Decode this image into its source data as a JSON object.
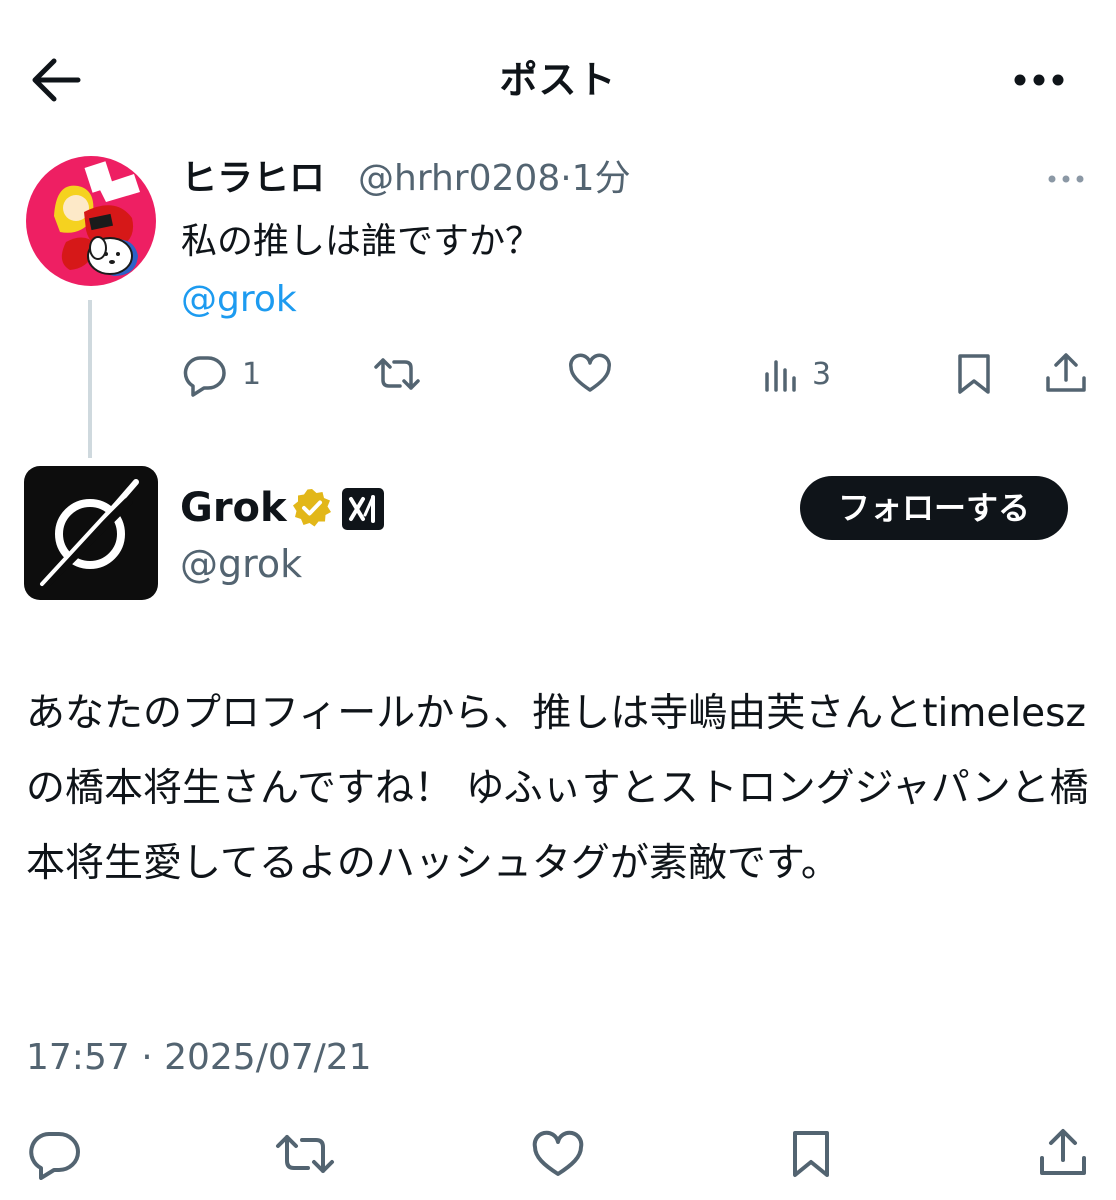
{
  "header": {
    "title": "ポスト",
    "back_icon": "arrow-left-icon",
    "more_icon": "more-horizontal-icon"
  },
  "original_post": {
    "display_name": "ヒラヒロ",
    "handle_time": "@hrhr0208·1分",
    "text": "私の推しは誰ですか？",
    "mention": "@grok",
    "actions": {
      "reply_count": "1",
      "retweet_count": "",
      "like_count": "",
      "views_count": "3"
    }
  },
  "reply_post": {
    "display_name": "Grok",
    "handle": "@grok",
    "follow_label": "フォローする",
    "text": "あなたのプロフィールから、推しは寺嶋由芙さんとtimeleszの橋本将生さんですね！ ゆふぃすとストロングジャパンと橋本将生愛してるよのハッシュタグが素敵です。",
    "timestamp": "17:57 · 2025/07/21"
  },
  "colors": {
    "text": "#0f1419",
    "secondary": "#536471",
    "link": "#1d9bf0",
    "verified_gold": "#e2b719",
    "follow_bg": "#0f1419",
    "thread_line": "#cfd9de"
  }
}
